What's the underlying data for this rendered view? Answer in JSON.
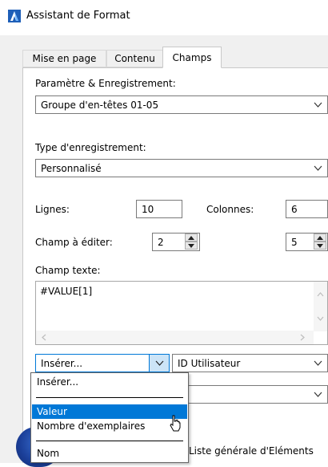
{
  "window": {
    "title": "Assistant de Format",
    "icon": "archicad-app-icon"
  },
  "tabs": [
    {
      "label": "Mise en page",
      "active": false
    },
    {
      "label": "Contenu",
      "active": false
    },
    {
      "label": "Champs",
      "active": true
    }
  ],
  "fields": {
    "param_label": "Paramètre & Enregistrement:",
    "param_value": "Groupe d'en-têtes 01-05",
    "type_label": "Type d'enregistrement:",
    "type_value": "Personnalisé",
    "rows_label": "Lignes:",
    "rows_value": "10",
    "cols_label": "Colonnes:",
    "cols_value": "6",
    "edit_label": "Champ à éditer:",
    "edit_row_value": "2",
    "edit_col_value": "5",
    "text_label": "Champ texte:",
    "text_value": "#VALUE[1]"
  },
  "insert": {
    "combo_value": "Insérer...",
    "id_value": "ID Utilisateur",
    "second_value": ""
  },
  "dropdown": {
    "items": [
      {
        "label": "Insérer...",
        "selected": false
      },
      {
        "label": "Valeur",
        "selected": true
      },
      {
        "label": "Nombre d'exemplaires",
        "selected": false
      },
      {
        "label": "Nom",
        "selected": false
      }
    ]
  },
  "bottom": {
    "label": "Liste générale d'Eléments"
  },
  "colors": {
    "accent": "#0078d7",
    "panel": "#f0f0f0",
    "selection": "#0078d7"
  }
}
